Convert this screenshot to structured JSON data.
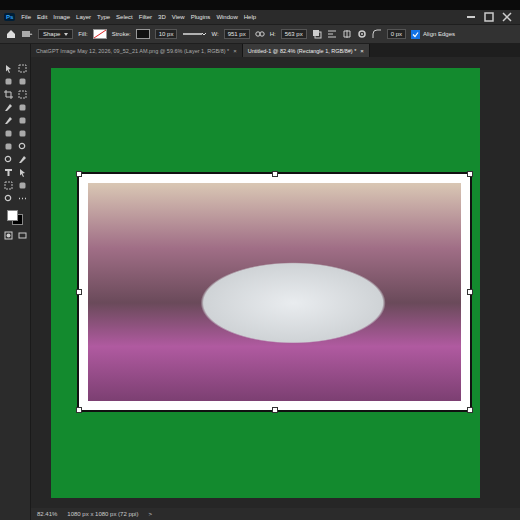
{
  "app": {
    "logo": "Ps"
  },
  "menu": [
    "File",
    "Edit",
    "Image",
    "Layer",
    "Type",
    "Select",
    "Filter",
    "3D",
    "View",
    "Plugins",
    "Window",
    "Help"
  ],
  "options_bar": {
    "tool": "Shape",
    "fill_label": "Fill:",
    "stroke_label": "Stroke:",
    "stroke_width": "10 px",
    "w_label": "W:",
    "w_value": "951 px",
    "h_label": "H:",
    "h_value": "563 px",
    "radius": "0 px",
    "align_edges": {
      "label": "Align Edges",
      "checked": true
    }
  },
  "tabs": [
    {
      "label": "ChatGPT Image May 12, 2026, 09_52_21 AM.png @ 59.6% (Layer 1, RGB/8) *",
      "close": "×",
      "selected": false
    },
    {
      "label": "Untitled-1 @ 82.4% (Rectangle 1, RGB/8#) *",
      "close": "×",
      "selected": true
    }
  ],
  "status_bar": {
    "zoom": "82.41%",
    "doc_size": "1080 px x 1080 px (72 ppi)",
    "arrow": ">"
  }
}
